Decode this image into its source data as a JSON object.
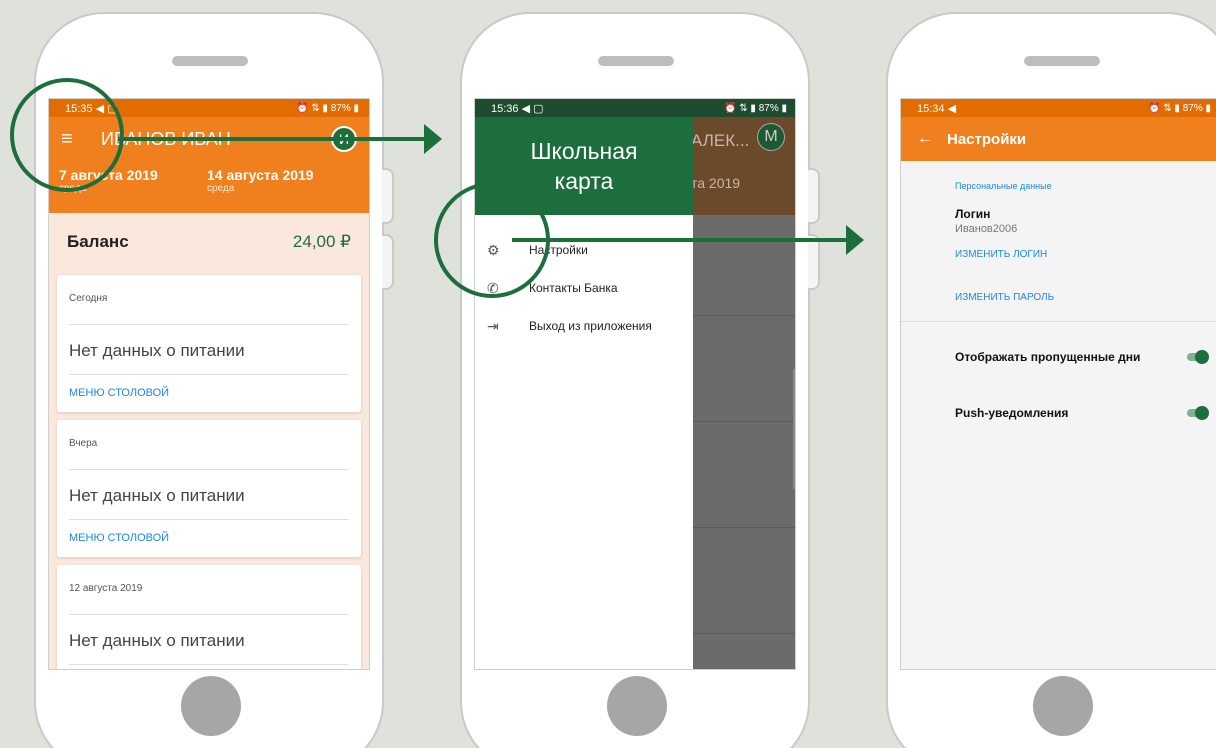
{
  "screen1": {
    "status": {
      "time": "15:35",
      "left_icons": "◀ ▢",
      "right_icons": "⏰ ⇅ ▮ 87% ▮"
    },
    "appbar": {
      "menu_icon": "≡",
      "title": "ИВАНОВ ИВАН",
      "avatar_letter": "И"
    },
    "dates": [
      {
        "date": "7 августа 2019",
        "weekday": "среда"
      },
      {
        "date": "14 августа 2019",
        "weekday": "среда"
      }
    ],
    "balance": {
      "label": "Баланс",
      "value": "24,00 ₽"
    },
    "cards": [
      {
        "day": "Сегодня",
        "status": "Нет данных о питании",
        "link": "МЕНЮ СТОЛОВОЙ"
      },
      {
        "day": "Вчера",
        "status": "Нет данных о питании",
        "link": "МЕНЮ СТОЛОВОЙ"
      },
      {
        "day": "12 августа 2019",
        "status": "Нет данных о питании",
        "link": ""
      }
    ]
  },
  "screen2": {
    "status": {
      "time": "15:36",
      "left_icons": "◀ ▢",
      "right_icons": "⏰ ⇅ ▮ 87% ▮"
    },
    "drawer_title_line1": "Школьная",
    "drawer_title_line2": "карта",
    "behind_title": "АЛЕК...",
    "behind_avatar": "М",
    "behind_date": "та 2019",
    "items": [
      {
        "icon": "⚙",
        "label": "Настройки"
      },
      {
        "icon": "✆",
        "label": "Контакты Банка"
      },
      {
        "icon": "⇥",
        "label": "Выход из приложения"
      }
    ]
  },
  "screen3": {
    "status": {
      "time": "15:34",
      "left_icons": "◀",
      "right_icons": "⏰ ⇅ ▮ 87% ▮"
    },
    "appbar": {
      "back_icon": "←",
      "title": "Настройки"
    },
    "section": "Персональные данные",
    "login_label": "Логин",
    "login_value": "Иванов2006",
    "change_login": "ИЗМЕНИТЬ ЛОГИН",
    "change_password": "ИЗМЕНИТЬ ПАРОЛЬ",
    "toggles": [
      {
        "label": "Отображать пропущенные дни",
        "on": true
      },
      {
        "label": "Push-уведомления",
        "on": true
      }
    ]
  },
  "colors": {
    "accent_orange": "#f07f1d",
    "status_orange": "#e36c00",
    "brand_green": "#1d6e3d",
    "link_blue": "#1e88e5",
    "background": "#dfe2da"
  }
}
